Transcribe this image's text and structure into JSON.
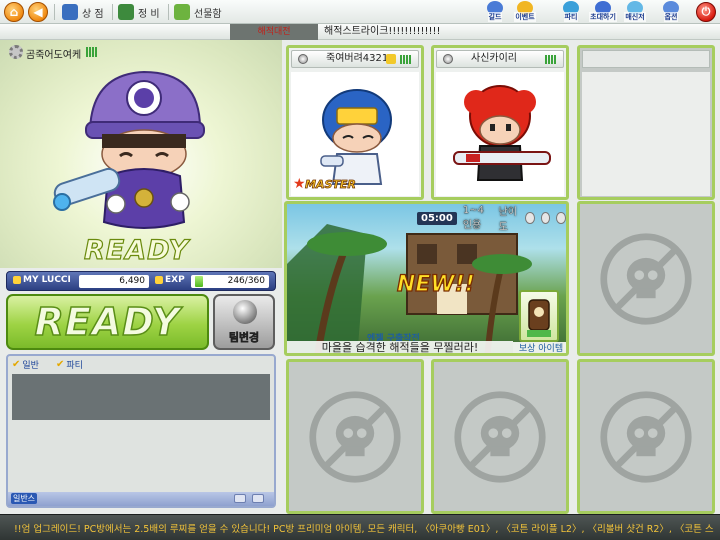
{
  "topbar": {
    "back_symbol": "◀",
    "menu": [
      {
        "label": "상 점",
        "icon": "shop-icon",
        "color": "#3a6fbf"
      },
      {
        "label": "정 비",
        "icon": "tools-icon",
        "color": "#3d8a3d"
      },
      {
        "label": "선물함",
        "icon": "gift-icon",
        "color": "#6db33f"
      }
    ],
    "right_icons": [
      {
        "label": "길드",
        "icon": "guild-icon",
        "color": "#4a7bd6"
      },
      {
        "label": "이벤트",
        "icon": "event-star-icon",
        "color": "#f1b623"
      },
      {
        "label": "파티",
        "icon": "party-icon",
        "color": "#3aa0d9"
      },
      {
        "label": "초대하기",
        "icon": "invite-icon",
        "color": "#3f6ed3"
      },
      {
        "label": "매신저",
        "icon": "messenger-icon",
        "color": "#63b8e6"
      },
      {
        "label": "옵션",
        "icon": "option-gear-icon",
        "color": "#5b8bdc"
      }
    ],
    "power_symbol": "⏻"
  },
  "room": {
    "mode": "해적대전",
    "name": "해적스트라이크!!!!!!!!!!!!!"
  },
  "player": {
    "nickname": "곰죽어도여케",
    "status": "READY",
    "lucci_label": "MY LUCCI",
    "lucci": "6,490",
    "exp_label": "EXP",
    "exp": "246/360",
    "exp_progress": 0.683
  },
  "buttons": {
    "ready": "READY",
    "team_change": "팀변경"
  },
  "chat": {
    "tabs": [
      "일반",
      "파티"
    ],
    "mode": "일반스"
  },
  "slots": [
    {
      "nickname": "죽여버려4321",
      "master": true,
      "master_label": "MASTER",
      "avatar": "blue-helmet-avatar"
    },
    {
      "nickname": "사신카이리",
      "master": false,
      "avatar": "red-hair-avatar"
    }
  ],
  "map": {
    "time": "05:00",
    "players": "1~4인용",
    "difficulty_label": "난이도",
    "new_label": "NEW!!",
    "mission": "엔젤 구출작전",
    "description": "마을을 습격한 해적들을 무찔러라!",
    "reward_label": "보상 아이템"
  },
  "ticker": "!!엄 업그레이드! PC방에서는 2.5배의 루찌를 얻을 수 있습니다! PC방 프리미엄 아이템, 모든 캐릭터, 〈아쿠아빵 E01〉, 〈코튼 라이플 L2〉, 〈리볼버 샷건 R2〉, 〈코튼 스나이퍼 라이플 I",
  "colors": {
    "slot_border": "#a6cd5e",
    "stats_bg": "#2c3f82",
    "ready_green": "#9ed344",
    "ticker_text": "#f2c33a"
  }
}
